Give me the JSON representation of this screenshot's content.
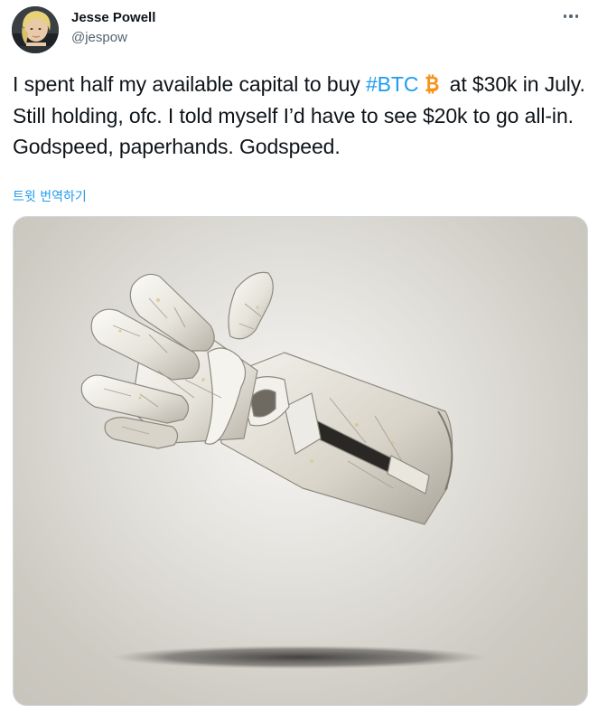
{
  "author": {
    "name": "Jesse Powell",
    "handle": "@jespow"
  },
  "tweet": {
    "text_before_hashtag": "I spent half my available capital to buy ",
    "hashtag": "#BTC",
    "emoji": "bitcoin-emoji",
    "text_after_hashtag": "  at $30k in July. Still holding, ofc. I told myself I’d have to see $20k to go all-in. Godspeed, paperhands. Godspeed.",
    "translate_label": "트윗 번역하기"
  },
  "media": {
    "image_subject": "paper-glove"
  },
  "colors": {
    "accent": "#1d9bf0",
    "text_primary": "#0f1419",
    "text_secondary": "#536471",
    "bitcoin": "#f7931a",
    "border": "#cfd9de"
  },
  "icons": {
    "more": "more-horizontal-icon",
    "bitcoin": "bitcoin-icon"
  }
}
